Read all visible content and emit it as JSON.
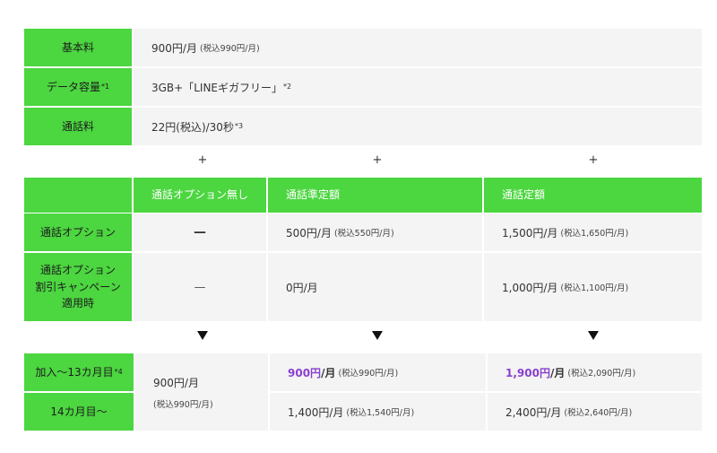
{
  "base": {
    "rows": [
      {
        "label": "基本料",
        "label_sup": "",
        "value": "900円/月",
        "value_small": "(税込990円/月)",
        "value_sup": ""
      },
      {
        "label": "データ容量",
        "label_sup": "*1",
        "value": "3GB+「LINEギガフリー」",
        "value_small": "",
        "value_sup": "*2"
      },
      {
        "label": "通話料",
        "label_sup": "",
        "value": "22円(税込)/30秒",
        "value_small": "",
        "value_sup": "*3"
      }
    ]
  },
  "plus_symbol": "+",
  "options": {
    "columns": [
      "通話オプション無し",
      "通話準定額",
      "通話定額"
    ],
    "rows": [
      {
        "label": "通話オプション",
        "cells": [
          {
            "main": "—",
            "small": ""
          },
          {
            "main": "500円/月",
            "small": "(税込550円/月)"
          },
          {
            "main": "1,500円/月",
            "small": "(税込1,650円/月)"
          }
        ]
      },
      {
        "label_lines": [
          "通話オプション",
          "割引キャンペーン",
          "適用時"
        ],
        "cells": [
          {
            "main": "—",
            "small": ""
          },
          {
            "main": "0円/月",
            "small": ""
          },
          {
            "main": "1,000円/月",
            "small": "(税込1,100円/月)"
          }
        ]
      }
    ]
  },
  "pricing": {
    "row1_label": "加入〜13カ月目",
    "row1_label_sup": "*4",
    "row2_label": "14カ月目〜",
    "merged_main": "900円/月",
    "merged_small": "(税込990円/月)",
    "row1": [
      {
        "price": "900円",
        "unit": "/月",
        "small": "(税込990円/月)"
      },
      {
        "price": "1,900円",
        "unit": "/月",
        "small": "(税込2,090円/月)"
      }
    ],
    "row2": [
      {
        "main": "1,400円/月",
        "small": "(税込1,540円/月)"
      },
      {
        "main": "2,400円/月",
        "small": "(税込2,640円/月)"
      }
    ]
  },
  "colors": {
    "accent_green": "#4cd640",
    "cell_gray": "#f4f4f4",
    "highlight_purple": "#8a3fcf"
  },
  "icons": {
    "arrow": "down-triangle-icon"
  }
}
